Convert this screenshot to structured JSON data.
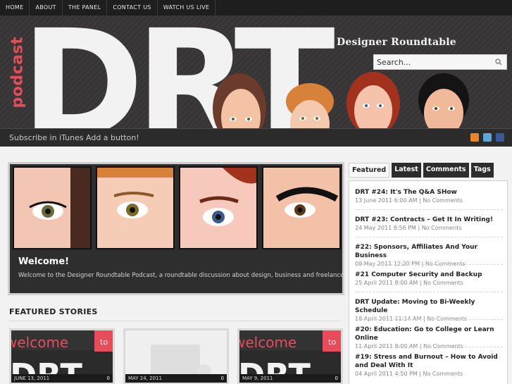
{
  "nav": [
    "HOME",
    "ABOUT",
    "THE PANEL",
    "CONTACT US",
    "WATCH US LIVE"
  ],
  "header": {
    "logo_text": "DRT",
    "podcast_text": "podcast",
    "site_title": "Designer Roundtable",
    "search_placeholder": "Search..."
  },
  "subbar": {
    "links": [
      "Subscribe in iTunes",
      "Add a button!"
    ],
    "social": [
      {
        "icon": "rss-icon",
        "color": "#e8842c"
      },
      {
        "icon": "twitter-icon",
        "color": "#5aa7d8"
      },
      {
        "icon": "facebook-icon",
        "color": "#3b5998"
      }
    ]
  },
  "featured": {
    "title": "Welcome!",
    "text": "Welcome to the Designer Roundtable Podcast, a roundtable discussion about design, business and freelance."
  },
  "featured_stories": {
    "heading": "FEATURED STORIES",
    "items": [
      {
        "date": "JUNE 13, 2011",
        "count": "0",
        "banner": "welcome",
        "tag": "to",
        "logo": "DRT"
      },
      {
        "date": "MAY 24, 2011",
        "count": "0",
        "banner": "",
        "tag": "",
        "logo": ""
      },
      {
        "date": "MAY 9, 2011",
        "count": "0",
        "banner": "welcome",
        "tag": "to",
        "logo": "DRT"
      }
    ]
  },
  "sidebar": {
    "tabs": [
      "Featured",
      "Latest",
      "Comments",
      "Tags"
    ],
    "active_tab": "Featured",
    "posts": [
      {
        "title": "DRT #24: It's The Q&A SHow",
        "meta": "13 June 2011 6:00 AM | No Comments"
      },
      {
        "title": "DRT #23: Contracts – Get It In Writing!",
        "meta": "24 May 2011 8:56 PM | No Comments"
      },
      {
        "title": "#22: Sponsors, Affiliates And Your Business",
        "meta": "09 May 2011 12:20 PM | No Comments"
      },
      {
        "title": "#21 Computer Security and Backup",
        "meta": "25 April 2011 8:00 AM | No Comments"
      },
      {
        "title": "DRT Update: Moving to Bi-Weekly Schedule",
        "meta": "18 April 2011 11:14 AM | No Comments"
      },
      {
        "title": "#20: Education: Go to College or Learn Online",
        "meta": "11 April 2011 8:00 AM | No Comments"
      },
      {
        "title": "#19: Stress and Burnout – How to Avoid and Deal With It",
        "meta": "04 April 2011 4:50 PM | No Comments"
      }
    ]
  },
  "colors": {
    "accent": "#e74c5b",
    "dark": "#2e2e2e"
  }
}
